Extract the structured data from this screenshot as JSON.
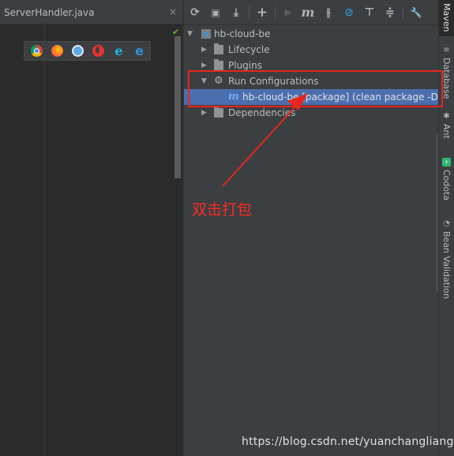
{
  "editor": {
    "tab_label": "ServerHandler.java",
    "tab_close": "×",
    "check_glyph": "✔",
    "browsers": [
      "chrome-icon",
      "firefox-icon",
      "safari-icon",
      "opera-icon",
      "ie-icon",
      "edge-icon"
    ]
  },
  "maven": {
    "toolbar": [
      {
        "name": "reimport-icon",
        "glyph": "⟳"
      },
      {
        "name": "generate-sources-icon",
        "glyph": "▣"
      },
      {
        "name": "download-icon",
        "glyph": "⤓"
      },
      {
        "name": "add-icon",
        "glyph": "+"
      },
      {
        "name": "run-icon",
        "glyph": "▶"
      },
      {
        "name": "execute-maven-goal-icon",
        "glyph": "m"
      },
      {
        "name": "toggle-offline-icon",
        "glyph": "⫲"
      },
      {
        "name": "skip-tests-icon",
        "glyph": "⊘"
      },
      {
        "name": "show-dependencies-icon",
        "glyph": "⊤"
      },
      {
        "name": "collapse-all-icon",
        "glyph": "≑"
      },
      {
        "name": "settings-icon",
        "glyph": "🔧"
      }
    ],
    "tree": {
      "root": "hb-cloud-be",
      "lifecycle": "Lifecycle",
      "plugins": "Plugins",
      "run_configurations": "Run Configurations",
      "run_config_item": "hb-cloud-be [package] (clean package -Ds",
      "dependencies": "Dependencies"
    }
  },
  "stripe": {
    "maven": "Maven",
    "database": "Database",
    "ant": "Ant",
    "codota": "Codota",
    "bean_validation": "Bean Validation"
  },
  "annotation": {
    "text": "双击打包",
    "color": "#e8261e"
  },
  "watermark": "https://blog.csdn.net/yuanchangliang",
  "colors": {
    "selection": "#4b6eaf",
    "panel": "#3c3f41",
    "editor": "#2b2b2b"
  }
}
